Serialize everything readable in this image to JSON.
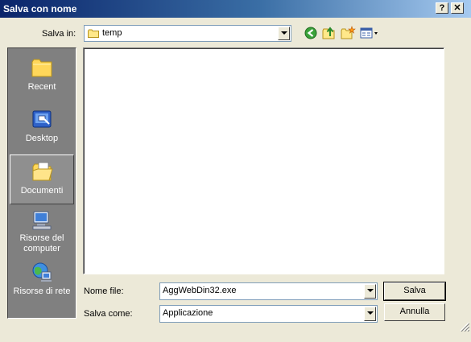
{
  "window": {
    "title": "Salva con nome",
    "help_glyph": "?",
    "close_glyph": "✕"
  },
  "savein": {
    "label": "Salva in:",
    "value": "temp"
  },
  "toolbar": {
    "icons": [
      "back-icon",
      "up-folder-icon",
      "new-folder-icon",
      "views-menu-icon"
    ]
  },
  "places": [
    {
      "label": "Recent",
      "icon": "recent-icon"
    },
    {
      "label": "Desktop",
      "icon": "desktop-icon"
    },
    {
      "label": "Documenti",
      "icon": "documents-icon",
      "selected": true
    },
    {
      "label": "Risorse del computer",
      "icon": "my-computer-icon"
    },
    {
      "label": "Risorse di rete",
      "icon": "network-icon"
    }
  ],
  "filename": {
    "label": "Nome file:",
    "value": "AggWebDin32.exe"
  },
  "filetype": {
    "label": "Salva come:",
    "value": "Applicazione"
  },
  "buttons": {
    "save": "Salva",
    "cancel": "Annulla"
  },
  "colors": {
    "titlebar_start": "#0a246a",
    "titlebar_end": "#a6caf0",
    "dialog_bg": "#ece9d8",
    "places_bg": "#808080"
  }
}
